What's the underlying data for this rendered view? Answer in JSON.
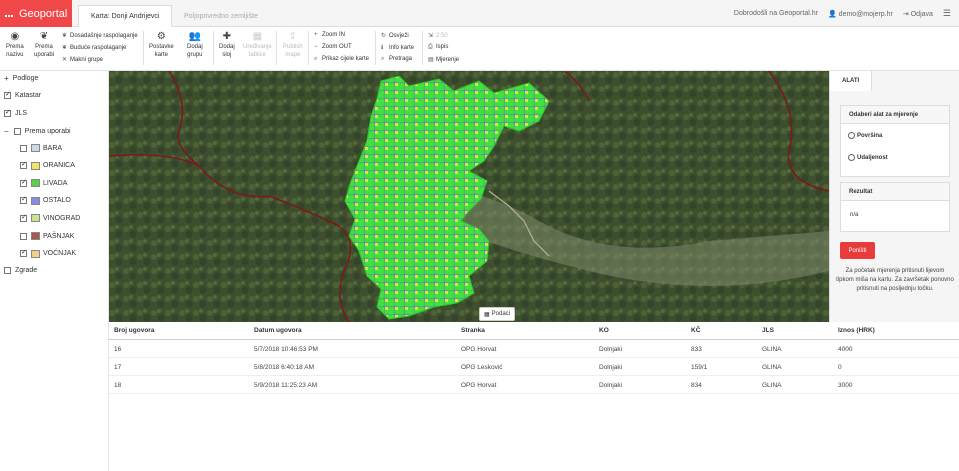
{
  "header": {
    "brand": "Geoportal",
    "tab_active": "Karta: Donji Andrijevci",
    "tab_inactive": "Poljoprivredno zemljište",
    "welcome": "Dobrodošli na Geoportal.hr",
    "user": "demo@mojerp.hr",
    "logout": "Odjava"
  },
  "toolbar": {
    "prema_nazivu": [
      "Prema",
      "nazivu"
    ],
    "prema_uporabi": [
      "Prema",
      "uporabi"
    ],
    "dosadasnje": "Dosadašnje raspolaganje",
    "buduce": "Buduće raspolaganje",
    "makni": "Makni grupe",
    "postavke": [
      "Postavke",
      "karte"
    ],
    "dodaj_grupu": [
      "Dodaj",
      "grupu"
    ],
    "dodaj_sloj": [
      "Dodaj",
      "sloj"
    ],
    "uredjivanje": [
      "Uređivanje",
      "tablice"
    ],
    "publish": [
      "Publish",
      "mape"
    ],
    "zoom_in": "Zoom IN",
    "zoom_out": "Zoom OUT",
    "prikaz": "Prikaz cijele karte",
    "osvjezi": "Osvježi",
    "info": "Info karte",
    "pretraga": "Pretraga",
    "ispis_zoom": "2:50",
    "ispis": "Ispis",
    "mjerenje": "Mjerenje"
  },
  "layers": {
    "podloge": "Podloge",
    "katastar": "Katastar",
    "jls": "JLS",
    "prema_uporabi": "Prema uporabi",
    "items": [
      {
        "label": "BARA",
        "color": "#c9d9e8",
        "checked": false
      },
      {
        "label": "ORANICA",
        "color": "#f3e36b",
        "checked": true
      },
      {
        "label": "LIVADA",
        "color": "#5bd14b",
        "checked": true
      },
      {
        "label": "OSTALO",
        "color": "#8b8ce0",
        "checked": true
      },
      {
        "label": "VINOGRAD",
        "color": "#c6e58c",
        "checked": true
      },
      {
        "label": "PAŠNJAK",
        "color": "#a85a4c",
        "checked": false
      },
      {
        "label": "VOĆNJAK",
        "color": "#f5d08a",
        "checked": true
      }
    ],
    "zgrade": "Zgrade"
  },
  "map": {
    "podaci_label": "Podaci"
  },
  "tools": {
    "tab": "ALATI",
    "measure_header": "Odaberi alat za mjerenje",
    "option_area": "Površina",
    "option_distance": "Udaljenost",
    "result_header": "Rezultat",
    "result_value": "n/a",
    "reset": "Poništi",
    "hint": "Za početak mjerenja pritisnuti lijevom tipkom miša na kartu. Za završetak ponovno pritisnuti na posljednju točku."
  },
  "table": {
    "columns": [
      "Broj ugovora",
      "Datum ugovora",
      "Stranka",
      "KO",
      "KČ",
      "JLS",
      "Iznos (HRK)"
    ],
    "rows": [
      [
        "16",
        "5/7/2018 10:46:53 PM",
        "OPG Horvat",
        "Dolnjaki",
        "833",
        "GLINA",
        "4000"
      ],
      [
        "17",
        "5/8/2018 6:40:18 AM",
        "OPG Lesković",
        "Dolnjaki",
        "159/1",
        "GLINA",
        "0"
      ],
      [
        "18",
        "5/9/2018 11:25:23 AM",
        "OPG Horvat",
        "Dolnjaki",
        "834",
        "GLINA",
        "3000"
      ]
    ]
  }
}
